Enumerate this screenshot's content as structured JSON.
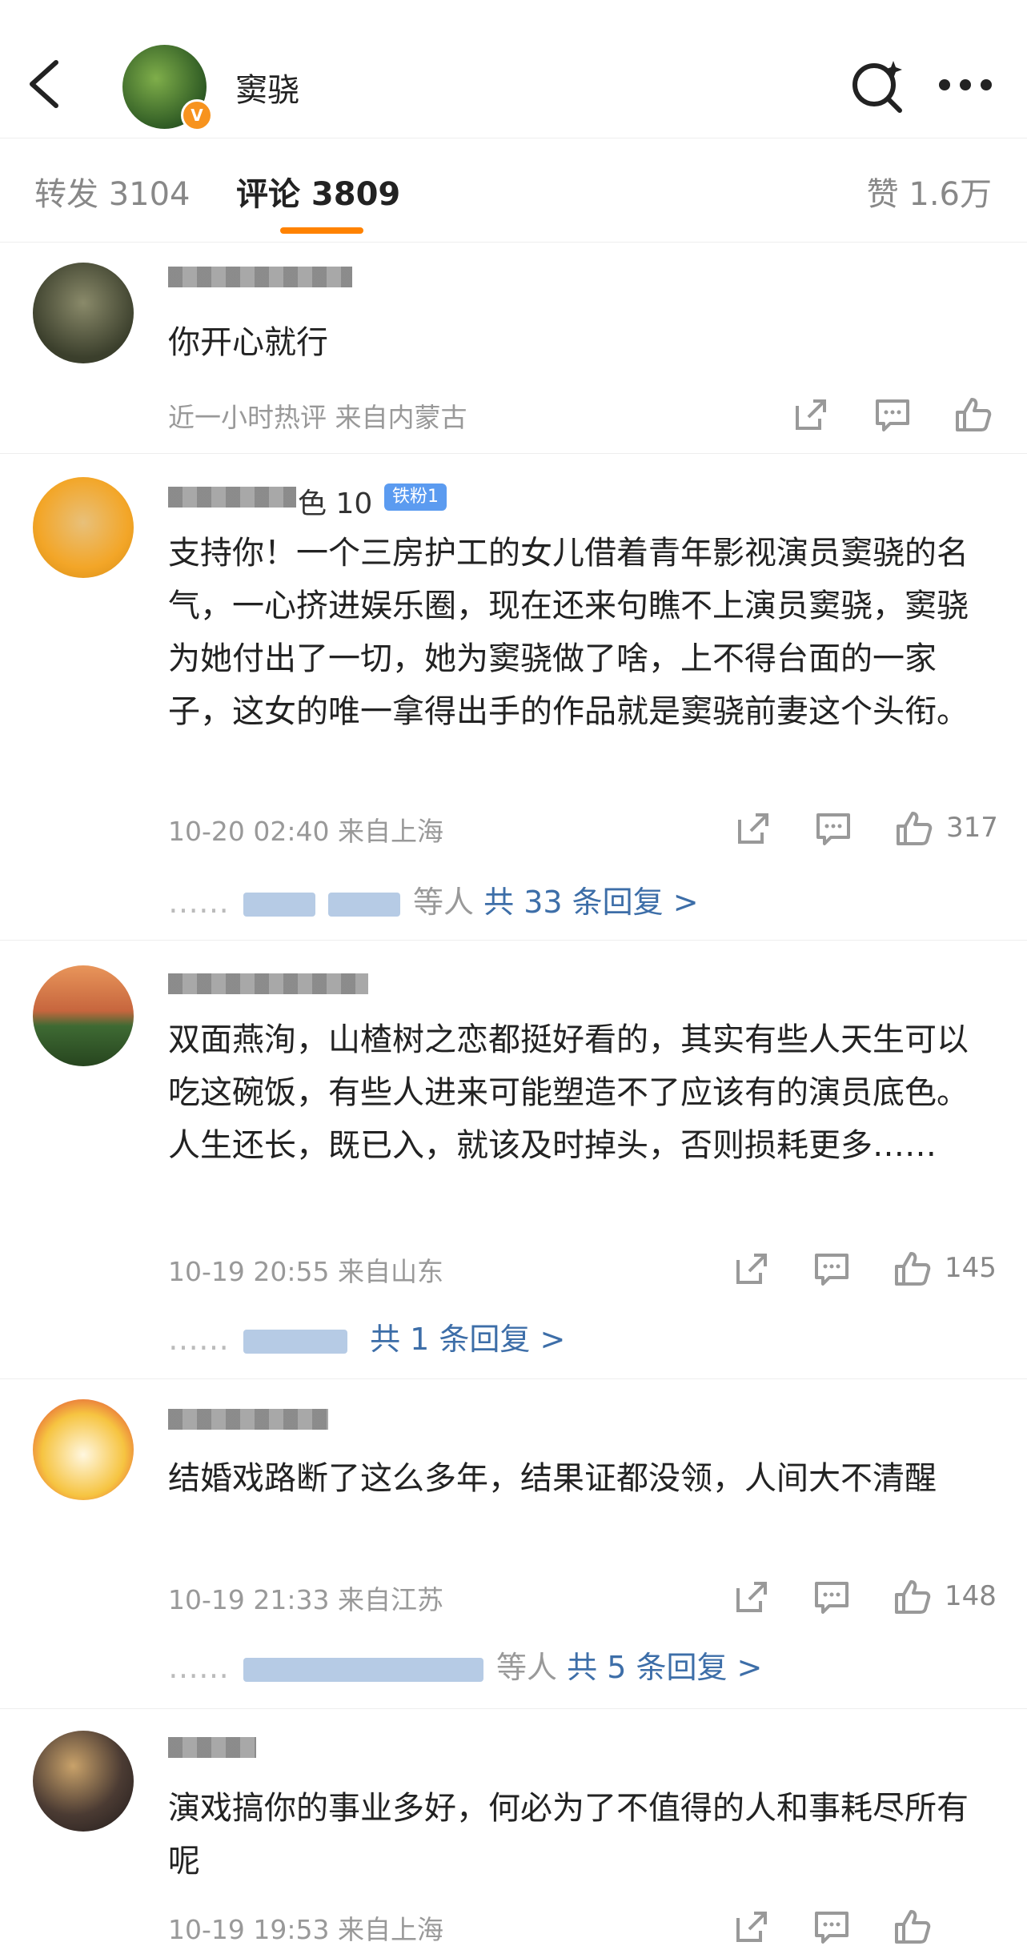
{
  "header": {
    "title": "窦骁",
    "badge": "V"
  },
  "tabs": {
    "repost": "转发 3104",
    "comment": "评论 3809",
    "like": "赞 1.6万"
  },
  "comments": [
    {
      "name": "",
      "badge": "",
      "text": "你开心就行",
      "meta": "近一小时热评  来自内蒙古",
      "likes": "",
      "replies": ""
    },
    {
      "name": "色 10",
      "badge": "铁粉1",
      "text": "支持你！一个三房护工的女儿借着青年影视演员窦骁的名气，一心挤进娱乐圈，现在还来句瞧不上演员窦骁，窦骁为她付出了一切，她为窦骁做了啥，上不得台面的一家子，这女的唯一拿得出手的作品就是窦骁前妻这个头衔。",
      "meta": "10-20 02:40  来自上海",
      "likes": "317",
      "replies_prefix": "等人",
      "replies": "共 33 条回复 >"
    },
    {
      "name": "",
      "badge": "",
      "text": "双面燕洵，山楂树之恋都挺好看的，其实有些人天生可以吃这碗饭，有些人进来可能塑造不了应该有的演员底色。人生还长，既已入，就该及时掉头，否则损耗更多……",
      "meta": "10-19 20:55  来自山东",
      "likes": "145",
      "replies_prefix": "",
      "replies": "共 1 条回复 >"
    },
    {
      "name": "",
      "badge": "",
      "text": "结婚戏路断了这么多年，结果证都没领，人间大不清醒",
      "meta": "10-19 21:33  来自江苏",
      "likes": "148",
      "replies_prefix": "等人",
      "replies": "共 5 条回复 >"
    },
    {
      "name": "",
      "badge": "",
      "text": "演戏搞你的事业多好，何必为了不值得的人和事耗尽所有呢",
      "meta": "10-19 19:53  来自上海",
      "likes": "",
      "replies": ""
    }
  ],
  "colors": {
    "accent": "#ff8200",
    "link": "#3d6ea8",
    "badge": "#5b9bf0"
  },
  "icons": [
    "back-arrow-icon",
    "search-icon",
    "more-icon",
    "share-icon",
    "comment-icon",
    "like-icon"
  ]
}
